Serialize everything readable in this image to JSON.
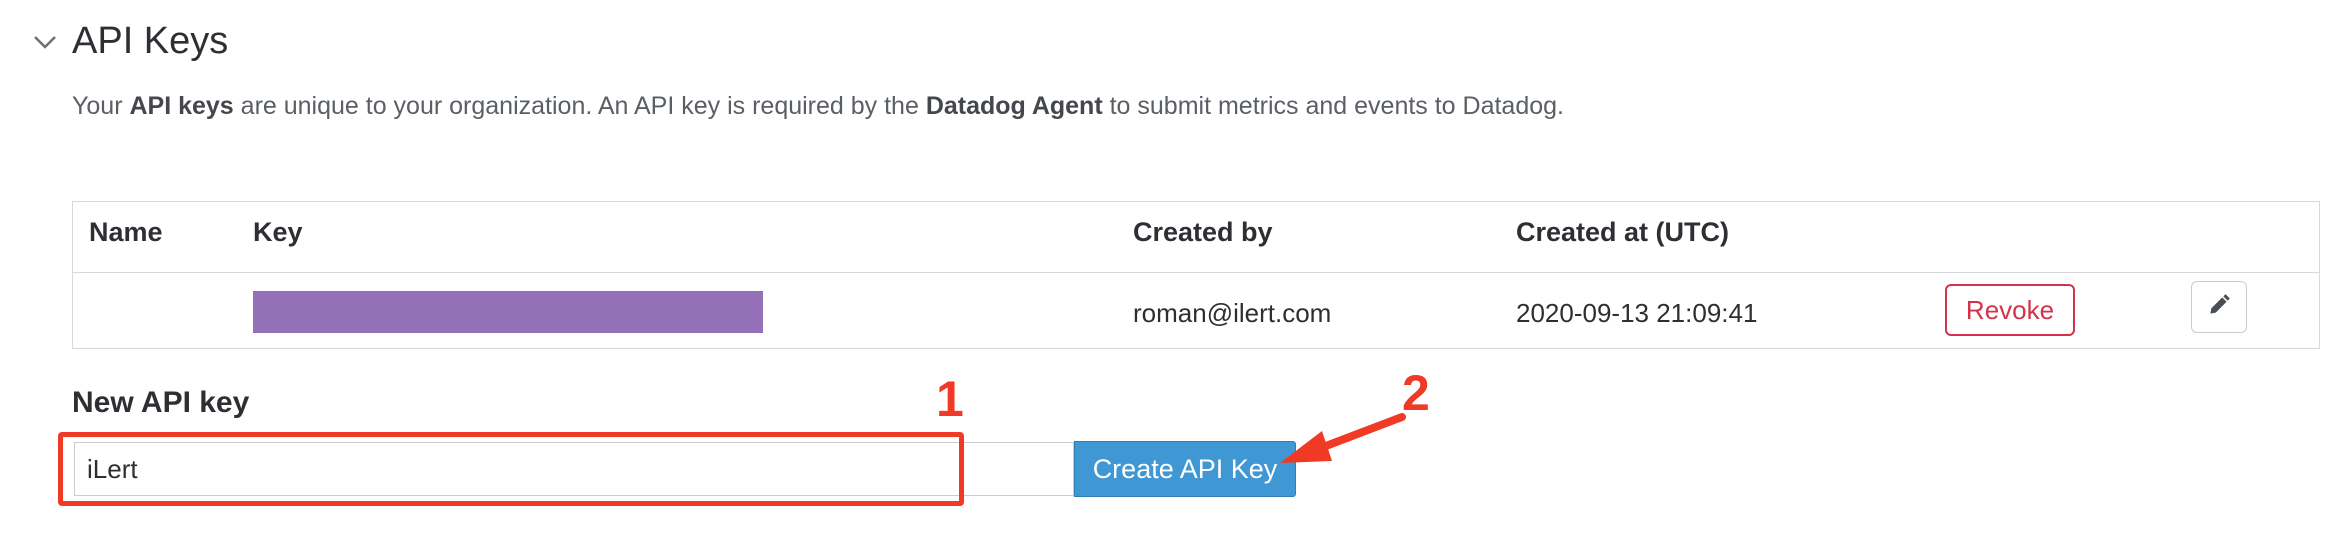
{
  "section": {
    "title": "API Keys",
    "description": {
      "part1": "Your ",
      "bold1": "API keys",
      "part2": " are unique to your organization. An API key is required by the ",
      "bold2": "Datadog Agent",
      "part3": " to submit metrics and events to Datadog."
    },
    "chevron_icon": "chevron-down-icon"
  },
  "table": {
    "columns": [
      "Name",
      "Key",
      "Created by",
      "Created at (UTC)"
    ],
    "rows": [
      {
        "name": "",
        "key_masked_color": "#9370b8",
        "created_by": "roman@ilert.com",
        "created_at": "2020-09-13 21:09:41",
        "revoke_label": "Revoke",
        "edit_icon": "pencil-icon"
      }
    ]
  },
  "new_key": {
    "label": "New API key",
    "input_value": "iLert",
    "create_button_label": "Create API Key"
  },
  "annotations": {
    "step1": "1",
    "step2": "2",
    "color": "#f03a26"
  },
  "colors": {
    "primary_button": "#3f97d3",
    "danger": "#d3334b"
  }
}
